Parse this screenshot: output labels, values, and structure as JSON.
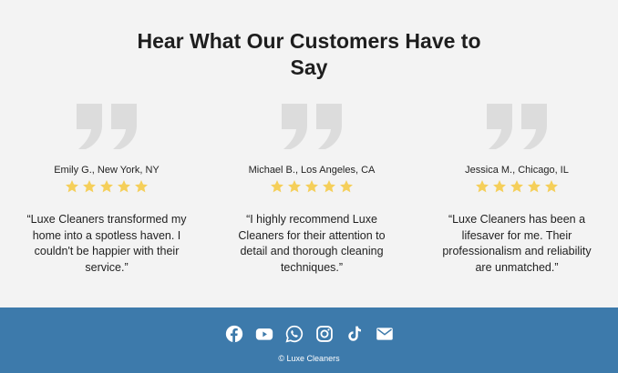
{
  "testimonials": {
    "title": "Hear What Our Customers Have to Say",
    "reviews": [
      {
        "author": "Emily G., New York, NY",
        "rating": 5,
        "text": "“Luxe Cleaners transformed my home into a spotless haven. I couldn't be happier with their service.”"
      },
      {
        "author": "Michael B., Los Angeles, CA",
        "rating": 5,
        "text": "“I highly recommend Luxe Cleaners for their attention to detail and thorough cleaning techniques.”"
      },
      {
        "author": "Jessica M., Chicago, IL",
        "rating": 5,
        "text": "“Luxe Cleaners has been a lifesaver for me. Their professionalism and reliability are unmatched.”"
      }
    ]
  },
  "footer": {
    "social_icons": [
      "facebook-icon",
      "youtube-icon",
      "whatsapp-icon",
      "instagram-icon",
      "tiktok-icon",
      "email-icon"
    ],
    "copyright": "© Luxe Cleaners"
  },
  "colors": {
    "background": "#f3f3f3",
    "footer": "#3d7aab",
    "star": "#f5cf5a",
    "quote_mark": "#dcdcdc"
  }
}
